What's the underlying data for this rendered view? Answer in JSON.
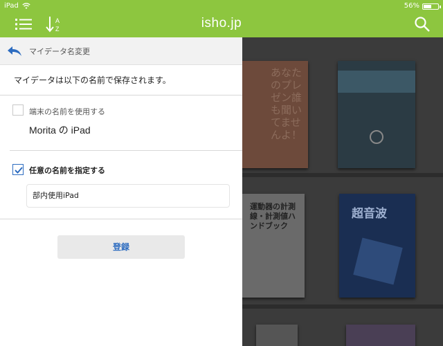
{
  "status_bar": {
    "carrier": "iPad",
    "time": "",
    "battery": "56%",
    "battery_level": 0.56
  },
  "nav": {
    "title": "isho.jp"
  },
  "panel": {
    "header_title": "マイデータ名変更",
    "description": "マイデータは以下の名前で保存されます。",
    "option_device": {
      "label": "端末の名前を使用する",
      "checked": false,
      "device_name": "Morita の iPad"
    },
    "option_custom": {
      "label": "任意の名前を指定する",
      "checked": true,
      "value": "部内使用iPad"
    },
    "register_label": "登録"
  },
  "background_books": {
    "book_a_text": "あなたのプレゼン誰も聞いてませんよ！",
    "book_c_text": "運動器の計測線・計測値ハンドブック",
    "book_d_text": "超音波"
  },
  "colors": {
    "nav_green": "#8dc63f",
    "accent_blue": "#2d6cc0"
  }
}
